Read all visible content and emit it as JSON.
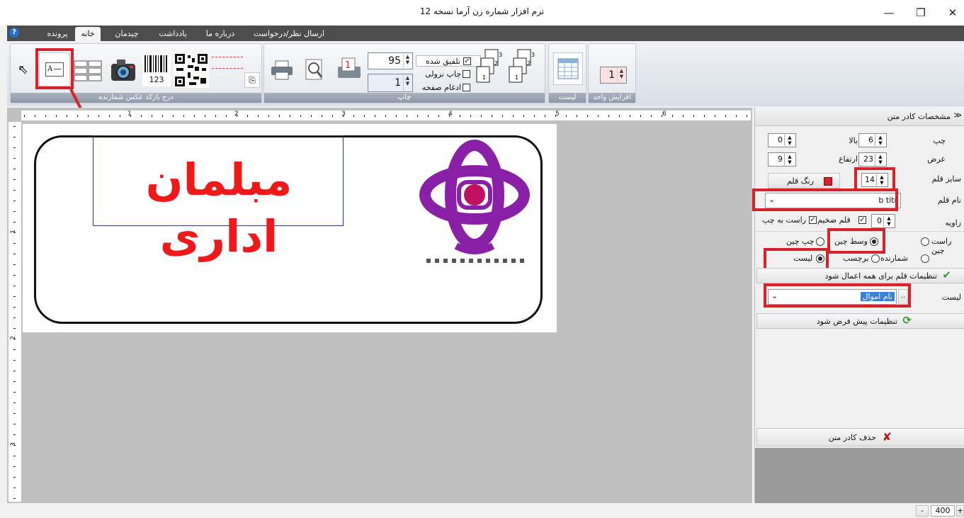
{
  "window": {
    "title": "نرم افزار شماره زن آرما نسخه 12",
    "minimize": "—",
    "maximize": "❐",
    "close": "✕"
  },
  "tabs": [
    "پرونده",
    "خانه",
    "چیدمان صفحه",
    "یادداشت",
    "درباره ما",
    "ارسال نظر/درخواست"
  ],
  "help_icon": "?",
  "ribbon": {
    "insert_group_label": "درج بارکد  عکس  شمارنده",
    "barcode_number": "123",
    "print_group_label": "چاپ",
    "print_top_value": "95",
    "print_bottom_value": "1",
    "opt_merge_label": "تلفیق شده",
    "opt_merge_checked": true,
    "opt_desc_label": "چاپ نزولی",
    "opt_page_merge_label": "ادغام صفحه",
    "list_group_label": "لیست",
    "increment_group_label": "افزایش واحد",
    "increment_value": "1",
    "stack_labels": [
      "3",
      "2",
      "1"
    ]
  },
  "ruler": {
    "top_marks": [
      "1",
      "2",
      "3",
      "4",
      "5",
      "6"
    ],
    "left_marks": [
      "1",
      "2",
      "3"
    ]
  },
  "label_text": "مبلمان اداری",
  "panel": {
    "header": "مشخصات کادر متن",
    "left_label": "چپ",
    "left_value": "6",
    "top_label": "بالا",
    "top_value": "0",
    "width_label": "عرض",
    "width_value": "23",
    "height_label": "ارتفاع",
    "height_value": "9",
    "font_size_label": "سایز قلم",
    "font_size_value": "14",
    "font_color_label": "رنگ قلم",
    "font_name_label": "نام قلم",
    "font_name_value": "b titr",
    "angle_label": "زاویه",
    "angle_value": "0",
    "bold_label": "قلم ضخیم",
    "rtl_label": "راست به چپ",
    "align_right": "راست چین",
    "align_center": "وسط چین",
    "align_left": "چپ چین",
    "type_counter": "شمارنده",
    "type_label": "برچسب",
    "type_list": "لیست",
    "apply_all": "تنظیمات قلم برای همه اعمال شود",
    "list_label": "لیست",
    "list_value": "نام اموال",
    "list_dots": "..",
    "default_settings": "تنظیمات پیش فرض شود",
    "delete_box": "حذف کادر متن"
  },
  "status": {
    "minus": "-",
    "zoom": "400",
    "plus": "+"
  },
  "colors": {
    "accent_red": "#d8222a",
    "logo_purple": "#8a1fa8",
    "label_text_red": "#f01818"
  }
}
